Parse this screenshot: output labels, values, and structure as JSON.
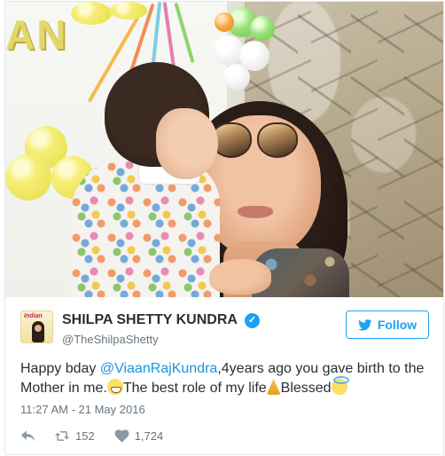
{
  "photo": {
    "banner_text": "AN"
  },
  "author": {
    "avatar_text": "Indian",
    "name": "SHILPA SHETTY KUNDRA",
    "handle": "@TheShilpaShetty",
    "verified": true
  },
  "follow_button": {
    "label": "Follow"
  },
  "tweet": {
    "text_prefix": "Happy bday ",
    "mention": "@ViaanRajKundra",
    "text_after_mention": ",4years ago you gave birth to the Mother in me.",
    "text_mid": "The best role of my life",
    "text_end": "Blessed",
    "emojis": [
      "grinning-face",
      "folded-hands",
      "smiling-face-with-halo"
    ],
    "timestamp": "11:27 AM - 21 May 2016"
  },
  "actions": {
    "reply_icon": "reply-icon",
    "retweet_icon": "retweet-icon",
    "like_icon": "heart-icon",
    "retweet_count": "152",
    "like_count": "1,724"
  },
  "colors": {
    "brand_blue": "#1da1f2",
    "mention_blue": "#1b95e0",
    "text": "#292f33",
    "muted": "#66757f",
    "border": "#e1e8ed"
  }
}
